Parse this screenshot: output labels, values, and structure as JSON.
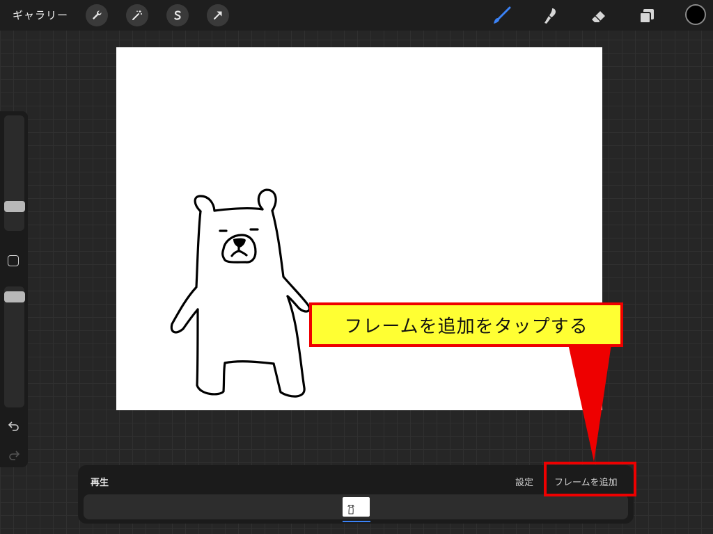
{
  "topbar": {
    "gallery_label": "ギャラリー",
    "left_tools": [
      "wrench-icon",
      "magic-wand-icon",
      "selection-s-icon",
      "transform-arrow-icon"
    ],
    "right_tools": [
      "brush-icon",
      "smudge-icon",
      "eraser-icon",
      "layers-icon"
    ],
    "active_color": "#000000",
    "brush_active_color": "#3b82f6"
  },
  "sidebar": {
    "modify_icon": "square-modify-icon",
    "undo_icon": "undo-icon",
    "redo_icon": "redo-icon"
  },
  "timeline": {
    "play_label": "再生",
    "settings_label": "設定",
    "add_frame_label": "フレームを追加",
    "frame_count": 1,
    "selected_frame": 1
  },
  "annotation": {
    "callout_text": "フレームを追加をタップする",
    "callout_bg": "#ffff33",
    "border_color": "#ee0000"
  }
}
